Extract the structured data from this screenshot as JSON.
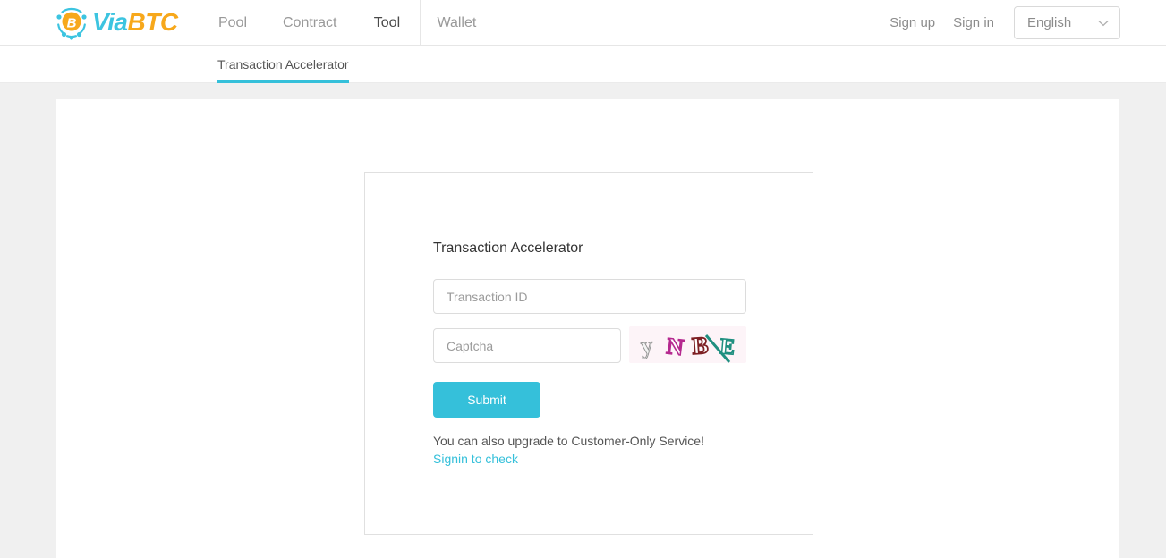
{
  "brand": {
    "name_first": "Via",
    "name_second": "BTC",
    "logo_icon": "bitcoin-node-icon",
    "color_via": "#3cc4e0",
    "color_btc": "#f7a81b"
  },
  "header": {
    "nav": [
      {
        "label": "Pool",
        "active": false
      },
      {
        "label": "Contract",
        "active": false
      },
      {
        "label": "Tool",
        "active": true
      },
      {
        "label": "Wallet",
        "active": false
      }
    ],
    "sign_up": "Sign up",
    "sign_in": "Sign in",
    "language": {
      "selected": "English",
      "chevron_icon": "chevron-down-icon"
    }
  },
  "subnav": {
    "items": [
      {
        "label": "Transaction Accelerator",
        "active": true
      }
    ],
    "accent_color": "#35c0da"
  },
  "main": {
    "card_title": "Transaction Accelerator",
    "transaction_id": {
      "placeholder": "Transaction ID",
      "value": ""
    },
    "captcha": {
      "placeholder": "Captcha",
      "value": "",
      "image_name": "captcha-image",
      "image_text": "yNBE"
    },
    "submit_label": "Submit",
    "note_text": "You can also upgrade to Customer-Only Service!",
    "note_link": "Signin to check"
  },
  "colors": {
    "accent": "#35c0da",
    "page_bg": "#f0f0f0",
    "panel_bg": "#ffffff",
    "border": "#e0e0e0"
  }
}
